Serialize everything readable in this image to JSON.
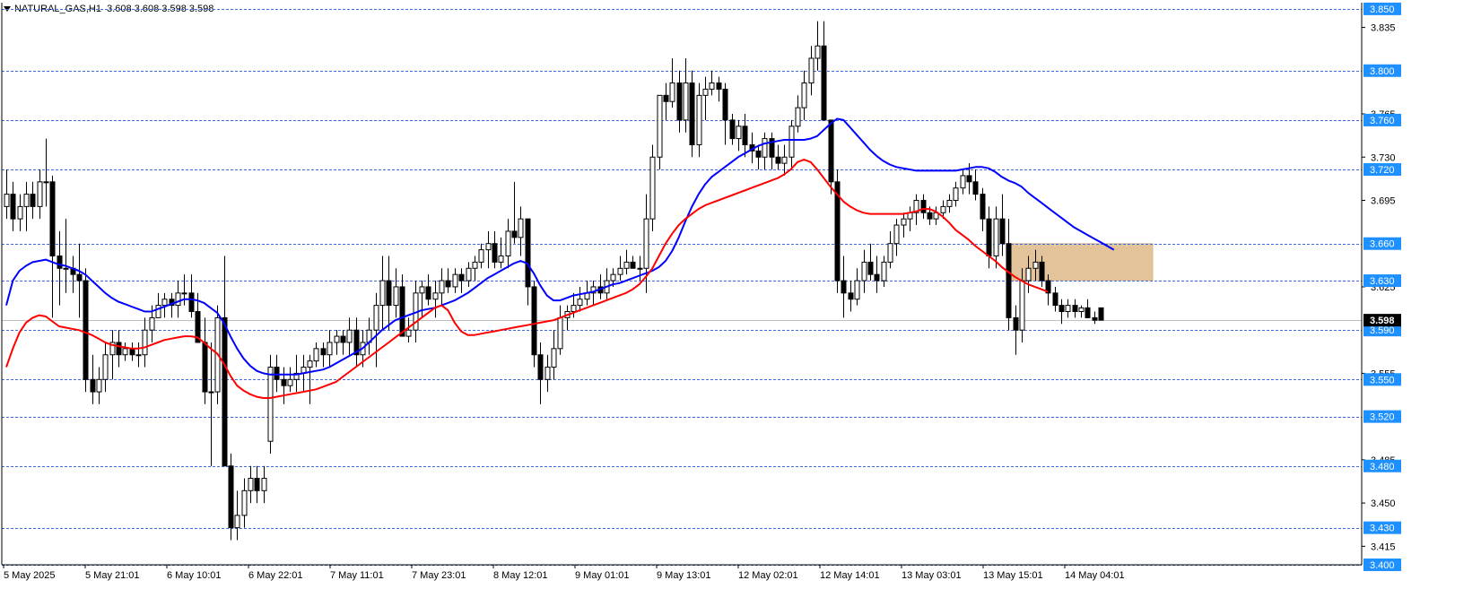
{
  "header": {
    "symbol": "NATURAL_GAS,H1",
    "ohlc": "3.608 3.608 3.598 3.598"
  },
  "chart_data": {
    "type": "candlestick",
    "ylim": [
      3.4,
      3.855
    ],
    "price_ticks": [
      "3.835",
      "3.765",
      "3.730",
      "3.695",
      "3.625",
      "3.555",
      "3.485",
      "3.450",
      "3.415"
    ],
    "levels": [
      {
        "value": 3.85,
        "label": "3.850"
      },
      {
        "value": 3.8,
        "label": "3.800"
      },
      {
        "value": 3.76,
        "label": "3.760"
      },
      {
        "value": 3.72,
        "label": "3.720"
      },
      {
        "value": 3.66,
        "label": "3.660"
      },
      {
        "value": 3.63,
        "label": "3.630"
      },
      {
        "value": 3.59,
        "label": "3.590"
      },
      {
        "value": 3.55,
        "label": "3.550"
      },
      {
        "value": 3.52,
        "label": "3.520"
      },
      {
        "value": 3.48,
        "label": "3.480"
      },
      {
        "value": 3.43,
        "label": "3.430"
      },
      {
        "value": 3.4,
        "label": "3.400"
      }
    ],
    "current_price": {
      "value": 3.598,
      "label": "3.598"
    },
    "time_labels": [
      "5 May 2025",
      "5 May 21:01",
      "6 May 10:01",
      "6 May 22:01",
      "7 May 11:01",
      "7 May 23:01",
      "8 May 12:01",
      "9 May 01:01",
      "9 May 13:01",
      "12 May 02:01",
      "12 May 14:01",
      "13 May 03:01",
      "13 May 15:01",
      "14 May 04:01"
    ],
    "candles": [
      [
        3.69,
        3.72,
        3.68,
        3.7
      ],
      [
        3.7,
        3.71,
        3.67,
        3.68
      ],
      [
        3.68,
        3.7,
        3.67,
        3.69
      ],
      [
        3.69,
        3.71,
        3.67,
        3.7
      ],
      [
        3.7,
        3.71,
        3.68,
        3.69
      ],
      [
        3.69,
        3.72,
        3.68,
        3.71
      ],
      [
        3.71,
        3.745,
        3.69,
        3.71
      ],
      [
        3.71,
        3.715,
        3.6,
        3.65
      ],
      [
        3.65,
        3.67,
        3.61,
        3.64
      ],
      [
        3.64,
        3.68,
        3.62,
        3.64
      ],
      [
        3.64,
        3.65,
        3.62,
        3.635
      ],
      [
        3.635,
        3.66,
        3.6,
        3.63
      ],
      [
        3.63,
        3.64,
        3.54,
        3.55
      ],
      [
        3.55,
        3.57,
        3.53,
        3.54
      ],
      [
        3.54,
        3.56,
        3.53,
        3.55
      ],
      [
        3.55,
        3.58,
        3.54,
        3.57
      ],
      [
        3.57,
        3.59,
        3.55,
        3.58
      ],
      [
        3.58,
        3.59,
        3.56,
        3.57
      ],
      [
        3.57,
        3.58,
        3.565,
        3.575
      ],
      [
        3.575,
        3.58,
        3.565,
        3.57
      ],
      [
        3.57,
        3.58,
        3.56,
        3.57
      ],
      [
        3.57,
        3.6,
        3.56,
        3.59
      ],
      [
        3.59,
        3.61,
        3.58,
        3.6
      ],
      [
        3.6,
        3.62,
        3.6,
        3.61
      ],
      [
        3.61,
        3.62,
        3.6,
        3.615
      ],
      [
        3.615,
        3.62,
        3.6,
        3.61
      ],
      [
        3.61,
        3.63,
        3.6,
        3.62
      ],
      [
        3.62,
        3.635,
        3.61,
        3.62
      ],
      [
        3.62,
        3.635,
        3.6,
        3.605
      ],
      [
        3.605,
        3.62,
        3.59,
        3.58
      ],
      [
        3.58,
        3.6,
        3.53,
        3.54
      ],
      [
        3.54,
        3.58,
        3.48,
        3.54
      ],
      [
        3.54,
        3.61,
        3.53,
        3.6
      ],
      [
        3.6,
        3.65,
        3.48,
        3.48
      ],
      [
        3.48,
        3.49,
        3.42,
        3.43
      ],
      [
        3.43,
        3.46,
        3.42,
        3.44
      ],
      [
        3.44,
        3.47,
        3.43,
        3.46
      ],
      [
        3.46,
        3.48,
        3.45,
        3.47
      ],
      [
        3.47,
        3.48,
        3.45,
        3.46
      ],
      [
        3.46,
        3.48,
        3.45,
        3.47
      ],
      [
        3.5,
        3.57,
        3.49,
        3.56
      ],
      [
        3.56,
        3.57,
        3.54,
        3.55
      ],
      [
        3.55,
        3.56,
        3.53,
        3.545
      ],
      [
        3.545,
        3.56,
        3.54,
        3.55
      ],
      [
        3.55,
        3.57,
        3.54,
        3.555
      ],
      [
        3.555,
        3.57,
        3.54,
        3.56
      ],
      [
        3.56,
        3.57,
        3.53,
        3.565
      ],
      [
        3.565,
        3.58,
        3.56,
        3.575
      ],
      [
        3.575,
        3.58,
        3.56,
        3.57
      ],
      [
        3.57,
        3.59,
        3.56,
        3.58
      ],
      [
        3.58,
        3.59,
        3.57,
        3.585
      ],
      [
        3.585,
        3.59,
        3.57,
        3.58
      ],
      [
        3.58,
        3.6,
        3.57,
        3.59
      ],
      [
        3.59,
        3.6,
        3.56,
        3.57
      ],
      [
        3.57,
        3.59,
        3.56,
        3.58
      ],
      [
        3.58,
        3.6,
        3.57,
        3.59
      ],
      [
        3.59,
        3.62,
        3.56,
        3.61
      ],
      [
        3.61,
        3.65,
        3.59,
        3.63
      ],
      [
        3.63,
        3.65,
        3.59,
        3.61
      ],
      [
        3.61,
        3.64,
        3.6,
        3.625
      ],
      [
        3.625,
        3.635,
        3.59,
        3.585
      ],
      [
        3.585,
        3.6,
        3.58,
        3.59
      ],
      [
        3.59,
        3.63,
        3.58,
        3.62
      ],
      [
        3.62,
        3.63,
        3.6,
        3.625
      ],
      [
        3.625,
        3.635,
        3.61,
        3.615
      ],
      [
        3.615,
        3.63,
        3.6,
        3.62
      ],
      [
        3.62,
        3.64,
        3.61,
        3.63
      ],
      [
        3.63,
        3.64,
        3.62,
        3.625
      ],
      [
        3.625,
        3.64,
        3.62,
        3.635
      ],
      [
        3.635,
        3.64,
        3.62,
        3.63
      ],
      [
        3.63,
        3.645,
        3.625,
        3.64
      ],
      [
        3.64,
        3.65,
        3.63,
        3.645
      ],
      [
        3.645,
        3.66,
        3.64,
        3.655
      ],
      [
        3.655,
        3.67,
        3.64,
        3.66
      ],
      [
        3.66,
        3.67,
        3.64,
        3.645
      ],
      [
        3.645,
        3.665,
        3.64,
        3.65
      ],
      [
        3.65,
        3.68,
        3.64,
        3.67
      ],
      [
        3.67,
        3.71,
        3.66,
        3.665
      ],
      [
        3.665,
        3.69,
        3.65,
        3.68
      ],
      [
        3.68,
        3.67,
        3.61,
        3.625
      ],
      [
        3.625,
        3.63,
        3.56,
        3.57
      ],
      [
        3.57,
        3.58,
        3.53,
        3.55
      ],
      [
        3.55,
        3.57,
        3.54,
        3.56
      ],
      [
        3.56,
        3.59,
        3.55,
        3.575
      ],
      [
        3.575,
        3.61,
        3.57,
        3.6
      ],
      [
        3.6,
        3.61,
        3.59,
        3.605
      ],
      [
        3.605,
        3.62,
        3.6,
        3.61
      ],
      [
        3.61,
        3.625,
        3.605,
        3.615
      ],
      [
        3.615,
        3.63,
        3.61,
        3.62
      ],
      [
        3.62,
        3.63,
        3.61,
        3.625
      ],
      [
        3.625,
        3.635,
        3.615,
        3.62
      ],
      [
        3.62,
        3.64,
        3.615,
        3.63
      ],
      [
        3.63,
        3.64,
        3.625,
        3.635
      ],
      [
        3.635,
        3.65,
        3.63,
        3.64
      ],
      [
        3.64,
        3.655,
        3.635,
        3.645
      ],
      [
        3.645,
        3.65,
        3.64,
        3.64
      ],
      [
        3.64,
        3.65,
        3.63,
        3.64
      ],
      [
        3.64,
        3.7,
        3.62,
        3.68
      ],
      [
        3.68,
        3.74,
        3.67,
        3.73
      ],
      [
        3.73,
        3.78,
        3.72,
        3.78
      ],
      [
        3.78,
        3.79,
        3.76,
        3.775
      ],
      [
        3.775,
        3.81,
        3.77,
        3.79
      ],
      [
        3.79,
        3.8,
        3.75,
        3.76
      ],
      [
        3.76,
        3.81,
        3.75,
        3.79
      ],
      [
        3.79,
        3.8,
        3.73,
        3.74
      ],
      [
        3.74,
        3.79,
        3.73,
        3.78
      ],
      [
        3.78,
        3.795,
        3.76,
        3.785
      ],
      [
        3.785,
        3.8,
        3.78,
        3.79
      ],
      [
        3.79,
        3.795,
        3.775,
        3.785
      ],
      [
        3.785,
        3.79,
        3.74,
        3.76
      ],
      [
        3.76,
        3.765,
        3.74,
        3.745
      ],
      [
        3.745,
        3.76,
        3.735,
        3.755
      ],
      [
        3.755,
        3.765,
        3.73,
        3.74
      ],
      [
        3.74,
        3.75,
        3.725,
        3.735
      ],
      [
        3.735,
        3.74,
        3.72,
        3.73
      ],
      [
        3.73,
        3.75,
        3.72,
        3.745
      ],
      [
        3.745,
        3.75,
        3.72,
        3.73
      ],
      [
        3.73,
        3.74,
        3.72,
        3.725
      ],
      [
        3.725,
        3.74,
        3.715,
        3.73
      ],
      [
        3.73,
        3.76,
        3.72,
        3.755
      ],
      [
        3.755,
        3.78,
        3.75,
        3.77
      ],
      [
        3.77,
        3.8,
        3.76,
        3.79
      ],
      [
        3.79,
        3.82,
        3.78,
        3.81
      ],
      [
        3.81,
        3.84,
        3.8,
        3.82
      ],
      [
        3.82,
        3.84,
        3.76,
        3.76
      ],
      [
        3.76,
        3.76,
        3.7,
        3.71
      ],
      [
        3.71,
        3.72,
        3.62,
        3.63
      ],
      [
        3.63,
        3.65,
        3.6,
        3.62
      ],
      [
        3.62,
        3.63,
        3.605,
        3.615
      ],
      [
        3.615,
        3.64,
        3.61,
        3.63
      ],
      [
        3.63,
        3.655,
        3.62,
        3.645
      ],
      [
        3.645,
        3.66,
        3.63,
        3.635
      ],
      [
        3.635,
        3.65,
        3.62,
        3.63
      ],
      [
        3.63,
        3.65,
        3.625,
        3.645
      ],
      [
        3.645,
        3.67,
        3.64,
        3.66
      ],
      [
        3.66,
        3.68,
        3.65,
        3.675
      ],
      [
        3.675,
        3.685,
        3.665,
        3.68
      ],
      [
        3.68,
        3.69,
        3.67,
        3.685
      ],
      [
        3.685,
        3.7,
        3.675,
        3.695
      ],
      [
        3.695,
        3.7,
        3.68,
        3.685
      ],
      [
        3.685,
        3.69,
        3.675,
        3.68
      ],
      [
        3.68,
        3.69,
        3.675,
        3.685
      ],
      [
        3.685,
        3.695,
        3.68,
        3.69
      ],
      [
        3.69,
        3.7,
        3.685,
        3.695
      ],
      [
        3.695,
        3.71,
        3.69,
        3.705
      ],
      [
        3.705,
        3.72,
        3.7,
        3.715
      ],
      [
        3.715,
        3.725,
        3.7,
        3.71
      ],
      [
        3.71,
        3.72,
        3.695,
        3.7
      ],
      [
        3.7,
        3.705,
        3.67,
        3.68
      ],
      [
        3.68,
        3.69,
        3.64,
        3.65
      ],
      [
        3.65,
        3.69,
        3.64,
        3.68
      ],
      [
        3.68,
        3.7,
        3.65,
        3.66
      ],
      [
        3.66,
        3.68,
        3.59,
        3.6
      ],
      [
        3.6,
        3.61,
        3.57,
        3.59
      ],
      [
        3.59,
        3.64,
        3.58,
        3.63
      ],
      [
        3.63,
        3.65,
        3.62,
        3.64
      ],
      [
        3.64,
        3.655,
        3.63,
        3.645
      ],
      [
        3.645,
        3.65,
        3.625,
        3.63
      ],
      [
        3.63,
        3.635,
        3.61,
        3.62
      ],
      [
        3.62,
        3.625,
        3.605,
        3.61
      ],
      [
        3.61,
        3.615,
        3.595,
        3.605
      ],
      [
        3.605,
        3.615,
        3.6,
        3.61
      ],
      [
        3.61,
        3.615,
        3.6,
        3.605
      ],
      [
        3.605,
        3.61,
        3.6,
        3.608
      ],
      [
        3.608,
        3.615,
        3.6,
        3.6
      ],
      [
        3.6,
        3.605,
        3.595,
        3.598
      ],
      [
        3.608,
        3.608,
        3.598,
        3.598
      ]
    ],
    "indicators": [
      {
        "color": "#0000ff",
        "values": [
          3.61,
          3.63,
          3.638,
          3.642,
          3.645,
          3.646,
          3.647,
          3.645,
          3.643,
          3.642,
          3.64,
          3.638,
          3.635,
          3.63,
          3.625,
          3.62,
          3.616,
          3.613,
          3.611,
          3.609,
          3.607,
          3.605,
          3.605,
          3.607,
          3.609,
          3.611,
          3.613,
          3.615,
          3.615,
          3.614,
          3.612,
          3.608,
          3.604,
          3.596,
          3.585,
          3.575,
          3.567,
          3.561,
          3.557,
          3.555,
          3.554,
          3.554,
          3.554,
          3.554,
          3.554,
          3.555,
          3.556,
          3.557,
          3.558,
          3.56,
          3.563,
          3.566,
          3.569,
          3.572,
          3.575,
          3.58,
          3.585,
          3.59,
          3.594,
          3.598,
          3.6,
          3.602,
          3.604,
          3.606,
          3.607,
          3.608,
          3.61,
          3.612,
          3.614,
          3.617,
          3.62,
          3.624,
          3.628,
          3.632,
          3.635,
          3.638,
          3.641,
          3.644,
          3.646,
          3.644,
          3.636,
          3.626,
          3.618,
          3.614,
          3.614,
          3.616,
          3.618,
          3.619,
          3.62,
          3.621,
          3.623,
          3.625,
          3.627,
          3.628,
          3.63,
          3.632,
          3.634,
          3.636,
          3.638,
          3.641,
          3.646,
          3.654,
          3.665,
          3.678,
          3.69,
          3.7,
          3.708,
          3.714,
          3.718,
          3.722,
          3.726,
          3.73,
          3.733,
          3.736,
          3.739,
          3.741,
          3.742,
          3.743,
          3.744,
          3.744,
          3.744,
          3.744,
          3.745,
          3.747,
          3.752,
          3.757,
          3.761,
          3.76,
          3.754,
          3.748,
          3.742,
          3.736,
          3.731,
          3.727,
          3.724,
          3.722,
          3.721,
          3.72,
          3.719,
          3.719,
          3.719,
          3.719,
          3.719,
          3.719,
          3.719,
          3.72,
          3.721,
          3.722,
          3.722,
          3.721,
          3.718,
          3.714,
          3.711,
          3.709,
          3.706,
          3.701,
          3.697,
          3.693,
          3.689,
          3.685,
          3.681,
          3.677,
          3.673,
          3.67,
          3.667,
          3.664,
          3.661,
          3.658,
          3.655
        ]
      },
      {
        "color": "#ff0000",
        "values": [
          3.56,
          3.575,
          3.588,
          3.596,
          3.6,
          3.602,
          3.601,
          3.597,
          3.593,
          3.592,
          3.591,
          3.59,
          3.588,
          3.586,
          3.583,
          3.58,
          3.578,
          3.577,
          3.576,
          3.575,
          3.575,
          3.576,
          3.578,
          3.58,
          3.582,
          3.583,
          3.584,
          3.585,
          3.585,
          3.584,
          3.58,
          3.575,
          3.571,
          3.563,
          3.553,
          3.545,
          3.541,
          3.538,
          3.536,
          3.535,
          3.535,
          3.536,
          3.537,
          3.538,
          3.539,
          3.54,
          3.541,
          3.542,
          3.544,
          3.546,
          3.548,
          3.552,
          3.556,
          3.56,
          3.564,
          3.568,
          3.572,
          3.576,
          3.58,
          3.584,
          3.588,
          3.592,
          3.596,
          3.6,
          3.604,
          3.608,
          3.61,
          3.606,
          3.596,
          3.589,
          3.586,
          3.586,
          3.587,
          3.588,
          3.589,
          3.59,
          3.591,
          3.592,
          3.593,
          3.594,
          3.595,
          3.596,
          3.597,
          3.598,
          3.6,
          3.602,
          3.604,
          3.606,
          3.608,
          3.61,
          3.612,
          3.614,
          3.616,
          3.618,
          3.62,
          3.623,
          3.627,
          3.633,
          3.64,
          3.65,
          3.66,
          3.668,
          3.675,
          3.68,
          3.684,
          3.688,
          3.691,
          3.693,
          3.695,
          3.697,
          3.699,
          3.701,
          3.703,
          3.705,
          3.707,
          3.709,
          3.711,
          3.713,
          3.716,
          3.72,
          3.726,
          3.728,
          3.726,
          3.72,
          3.713,
          3.706,
          3.7,
          3.694,
          3.69,
          3.687,
          3.685,
          3.684,
          3.684,
          3.684,
          3.684,
          3.684,
          3.684,
          3.685,
          3.686,
          3.688,
          3.688,
          3.686,
          3.682,
          3.677,
          3.671,
          3.667,
          3.663,
          3.658,
          3.654,
          3.65,
          3.646,
          3.641,
          3.637,
          3.633,
          3.63,
          3.627,
          3.625,
          3.623,
          3.621
        ]
      }
    ],
    "zone": {
      "from_value": 3.66,
      "to_value": 3.63,
      "color": "#deb887"
    },
    "grid": false,
    "colors": {
      "level_line": "#4169e1",
      "level_label_bg": "#1e90ff",
      "current_label_bg": "#000000",
      "current_line": "#c0c0c0",
      "bull_body": "#ffffff",
      "bear_body": "#000000",
      "candle_outline": "#000000"
    }
  }
}
